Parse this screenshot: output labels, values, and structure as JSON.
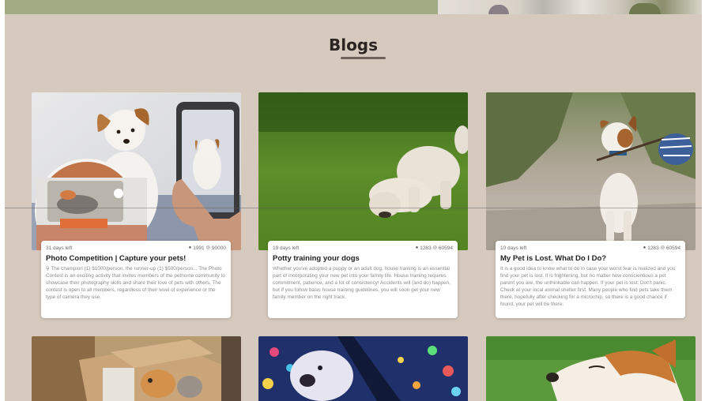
{
  "section": {
    "title": "Blogs"
  },
  "cards": [
    {
      "days_left": "31 days left",
      "comments": "1991",
      "views": "90000",
      "title": "Photo Competition | Capture your pets!",
      "excerpt": "The champion (1) $1000/person, the runner-up (1) $500/person... The Photo Contest is an exciting activity that invites members of the pethome community to showcase their photography skills and share their love of pets with others. The contest is open to all members, regardless of their level of experience or the type of camera they use.",
      "image_icon": "dog-phone-photo-image"
    },
    {
      "days_left": "19 days left",
      "comments": "1283",
      "views": "60594",
      "title": "Potty training your dogs",
      "excerpt": "Whether you've adopted a puppy or an adult dog, house training is an essential part of incorporating your new pet into your family life. House training requires commitment, patience, and a lot of consistency! Accidents will (and do) happen, but if you follow basic house training guidelines, you will soon get your new family member on the right track.",
      "image_icon": "poodle-grass-image"
    },
    {
      "days_left": "10 days left",
      "comments": "1283",
      "views": "60594",
      "title": "My Pet is Lost. What Do I Do?",
      "excerpt": "It is a good idea to know what to do in case your worst fear is realized and you find your pet is lost. It is frightening, but no matter how conscientious a pet parent you are, the unthinkable can happen. If your pet is lost: Don't panic. Check at your local animal shelter first. Many people who find pets take them there, hopefully after checking for a microchip, so there is a good chance if found, your pet will be there.",
      "image_icon": "dog-bindle-road-image"
    }
  ],
  "bottom_cards": [
    {
      "image_icon": "cats-in-box-image"
    },
    {
      "image_icon": "dog-bokeh-lights-image"
    },
    {
      "image_icon": "corgi-grass-image"
    }
  ],
  "colors": {
    "background": "#d6c9be",
    "title": "#2b2420",
    "card": "#ffffff",
    "muted_text": "#8b8b8b"
  }
}
